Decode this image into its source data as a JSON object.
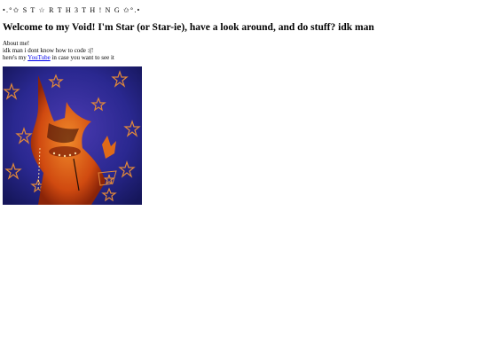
{
  "header": {
    "site_title": "•.°✩ S T ☆ R T H 3 T H ! N G ✩°.•",
    "heading": "Welcome to my Void! I'm Star (or Star-ie), have a look around, and do stuff? idk man"
  },
  "about": {
    "title": "About me!",
    "line1": "idk man i dont know how to code :(!",
    "line2_prefix": "here's my ",
    "youtube_link": "YouTube",
    "line2_suffix": " in case you want to see it"
  },
  "image": {
    "description_icon": "artwork-image",
    "colors": {
      "background_dark": "#1a1c6e",
      "background_mid": "#3b2f9e",
      "creature_orange": "#e05a10",
      "creature_red": "#b02a08",
      "star_orange": "#e0883a"
    }
  }
}
